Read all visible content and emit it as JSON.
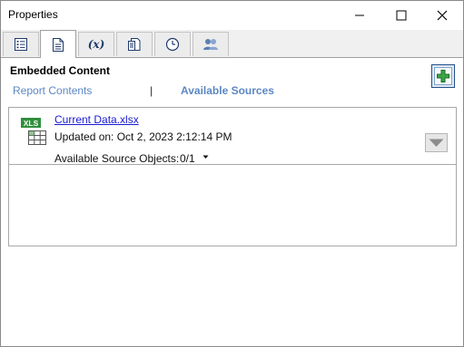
{
  "window": {
    "title": "Properties",
    "controls": {
      "minimize": "minimize-icon",
      "maximize": "maximize-icon",
      "close": "close-icon"
    }
  },
  "tabs": [
    {
      "icon": "list-icon",
      "active": false
    },
    {
      "icon": "document-icon",
      "active": true
    },
    {
      "icon": "variable-icon",
      "glyph": "(x)",
      "active": false
    },
    {
      "icon": "pages-icon",
      "active": false
    },
    {
      "icon": "clock-icon",
      "active": false
    },
    {
      "icon": "users-icon",
      "active": false
    }
  ],
  "section": {
    "title": "Embedded Content",
    "add_icon": "add-icon",
    "accent_color": "#2e9d3a"
  },
  "subtabs": {
    "left": "Report Contents",
    "separator": "|",
    "right": "Available Sources",
    "link_color": "#5b87c3"
  },
  "source": {
    "icon": "xls-file-icon",
    "icon_text": "XLS",
    "file_name": "Current Data.xlsx",
    "updated": "Updated on: Oct 2, 2023 2:12:14 PM",
    "objects_label": "Available Source Objects:",
    "objects_value": "0/1",
    "expand_icon": "triangle-down-icon"
  }
}
